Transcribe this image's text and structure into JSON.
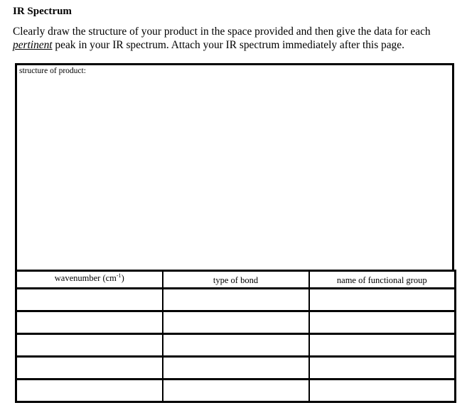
{
  "section": {
    "title": "IR Spectrum",
    "instructions": {
      "part1": "Clearly draw the structure of your product in the space provided and then give the data for each ",
      "emphasis": "pertinent",
      "part2": " peak in your IR spectrum.  Attach your IR spectrum immediately after this page."
    }
  },
  "structure_box": {
    "label": "structure of product:",
    "value": ""
  },
  "table": {
    "headers": {
      "wavenumber": {
        "label": "wavenumber (cm",
        "superscript": "-1",
        "close": ")"
      },
      "bond_type": "type of bond",
      "functional_group": "name of functional group"
    },
    "rows": [
      {
        "wavenumber": "",
        "bond_type": "",
        "functional_group": ""
      },
      {
        "wavenumber": "",
        "bond_type": "",
        "functional_group": ""
      },
      {
        "wavenumber": "",
        "bond_type": "",
        "functional_group": ""
      },
      {
        "wavenumber": "",
        "bond_type": "",
        "functional_group": ""
      },
      {
        "wavenumber": "",
        "bond_type": "",
        "functional_group": ""
      }
    ]
  }
}
